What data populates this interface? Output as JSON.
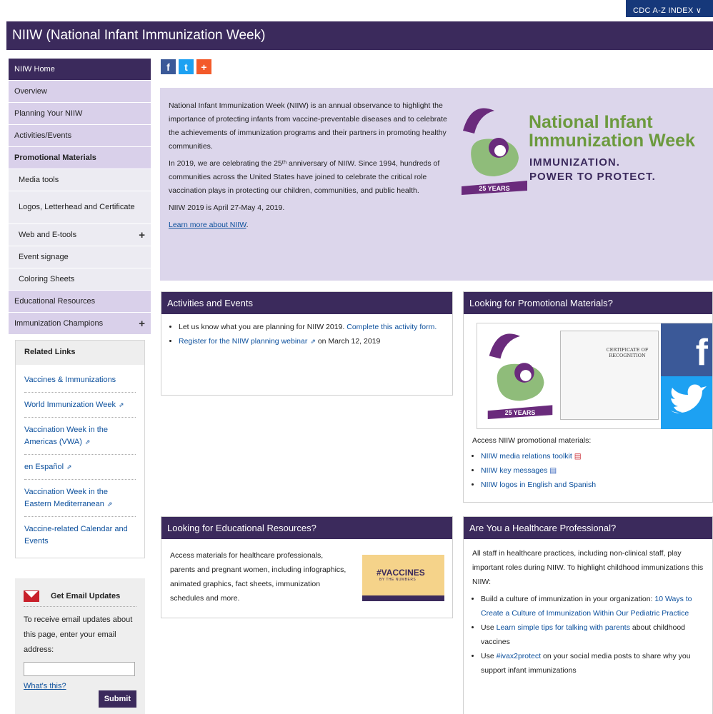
{
  "top": {
    "az_index": "CDC A-Z INDEX ∨"
  },
  "title": "NIIW (National Infant Immunization Week)",
  "sidebar": {
    "items": [
      {
        "label": "NIIW Home",
        "type": "home"
      },
      {
        "label": "Overview"
      },
      {
        "label": "Planning Your NIIW"
      },
      {
        "label": "Activities/Events"
      },
      {
        "label": "Promotional Materials",
        "type": "bold"
      },
      {
        "label": "Media tools",
        "type": "sub"
      },
      {
        "label": "Logos, Letterhead and Certificate",
        "type": "sub"
      },
      {
        "label": "Web and E-tools",
        "type": "sub",
        "expand": "+"
      },
      {
        "label": "Event signage",
        "type": "sub"
      },
      {
        "label": "Coloring Sheets",
        "type": "sub"
      },
      {
        "label": "Educational Resources"
      },
      {
        "label": "Immunization Champions",
        "expand": "+"
      }
    ]
  },
  "related": {
    "title": "Related Links",
    "links": [
      "Vaccines & Immunizations",
      "World Immunization Week",
      "Vaccination Week in the Americas (VWA)",
      "en Español",
      "Vaccination Week in the Eastern Mediterranean",
      "Vaccine-related Calendar and Events"
    ]
  },
  "email": {
    "title": "Get Email Updates",
    "text": "To receive email updates about this page, enter your email address:",
    "input_value": "",
    "whats_this": "What's this?",
    "submit": "Submit"
  },
  "share": {
    "fb": "f",
    "tw": "t",
    "plus": "+"
  },
  "hero": {
    "p1": "National Infant Immunization Week (NIIW) is an annual observance to highlight the importance of protecting infants from vaccine-preventable diseases and to celebrate the achievements of immunization programs and their partners in promoting healthy communities.",
    "p2": "In 2019, we are celebrating the 25ᵗʰ anniversary of NIIW.  Since 1994, hundreds of communities across the United States have joined to celebrate the critical role vaccination plays in protecting our children, communities, and public health.",
    "p3": "NIIW 2019 is April 27-May 4, 2019.",
    "link": "Learn more about NIIW",
    "logo_line1": "National Infant",
    "logo_line2": "Immunization Week",
    "tag_line1": "IMMUNIZATION.",
    "tag_line2": "POWER TO PROTECT.",
    "badge": "25 YEARS"
  },
  "activities": {
    "title": "Activities and Events",
    "item1_text": "Let us know what you are planning for NIIW 2019.",
    "item1_link": "Complete this activity form.",
    "item2_link": "Register for the NIIW planning webinar",
    "item2_text": "on March 12, 2019"
  },
  "promo": {
    "title": "Looking for Promotional Materials?",
    "access": "Access NIIW promotional materials:",
    "links": [
      "NIIW media relations toolkit",
      "NIIW key messages",
      "NIIW logos in English and Spanish"
    ],
    "cert_title": "CERTIFICATE OF RECOGNITION",
    "badge": "25 YEARS"
  },
  "edu": {
    "title": "Looking for Educational Resources?",
    "text": "Access materials for healthcare professionals, parents and pregnant women, including infographics, animated graphics, fact sheets, immunization schedules and more.",
    "img_title": "#VACCINES",
    "img_sub": "BY THE NUMBERS"
  },
  "hcp": {
    "title": "Are You a Healthcare Professional?",
    "text": "All staff in healthcare practices, including non-clinical staff, play important roles during NIIW. To highlight childhood immunizations this NIIW:",
    "b1_text": "Build a culture of immunization in your organization:",
    "b1_link": "10 Ways to Create a Culture of Immunization Within Our Pediatric Practice",
    "b2_pre": "Use",
    "b2_link": "Learn simple tips for talking with parents",
    "b2_post": "about childhood vaccines",
    "b3_pre": "Use",
    "b3_link": "#ivax2protect",
    "b3_post": "on your social media posts to share why you support infant immunizations"
  }
}
